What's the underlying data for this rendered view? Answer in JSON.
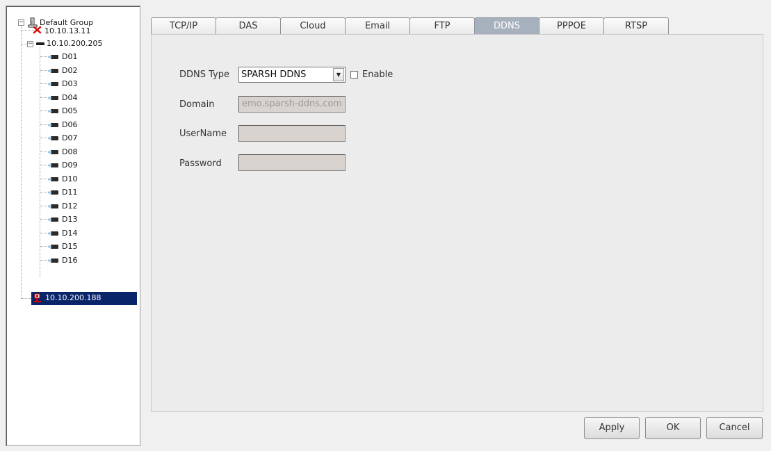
{
  "tree": {
    "root_label": "Default Group",
    "device_offline": "10.10.13.11",
    "device_nvr": "10.10.200.205",
    "channels": [
      "D01",
      "D02",
      "D03",
      "D04",
      "D05",
      "D06",
      "D07",
      "D08",
      "D09",
      "D10",
      "D11",
      "D12",
      "D13",
      "D14",
      "D15",
      "D16"
    ],
    "device_selected": "10.10.200.188",
    "expander_symbol": "−",
    "selected_color": "#0a246a"
  },
  "tabs": [
    {
      "label": "TCP/IP",
      "active": false
    },
    {
      "label": "DAS",
      "active": false
    },
    {
      "label": "Cloud",
      "active": false
    },
    {
      "label": "Email",
      "active": false
    },
    {
      "label": "FTP",
      "active": false
    },
    {
      "label": "DDNS",
      "active": true
    },
    {
      "label": "PPPOE",
      "active": false
    },
    {
      "label": "RTSP",
      "active": false
    }
  ],
  "ddns": {
    "type_label": "DDNS Type",
    "type_value": "SPARSH DDNS",
    "enable_label": "Enable",
    "enable_checked": false,
    "domain_label": "Domain",
    "domain_value": "emo.sparsh-ddns.com",
    "username_label": "UserName",
    "username_value": "",
    "password_label": "Password",
    "password_value": ""
  },
  "buttons": {
    "apply": "Apply",
    "ok": "OK",
    "cancel": "Cancel"
  }
}
